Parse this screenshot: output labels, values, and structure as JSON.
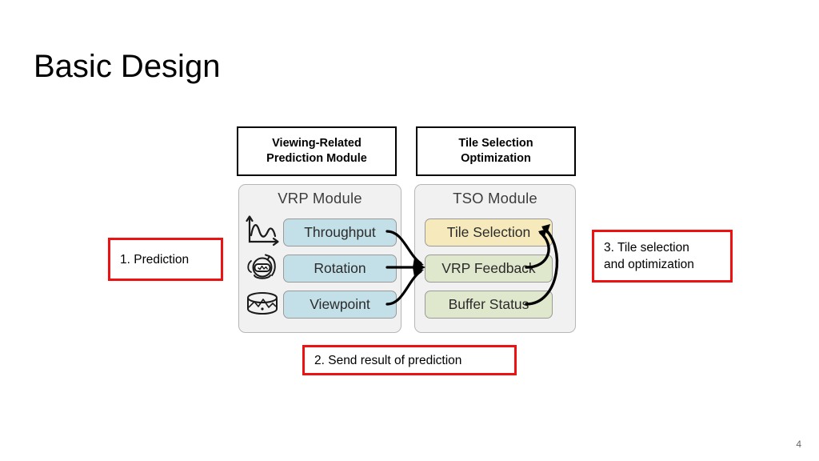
{
  "slide": {
    "title": "Basic Design",
    "page_number": "4"
  },
  "diagram": {
    "captions": {
      "left": "Viewing-Related\nPrediction Module",
      "left_line1": "Viewing-Related",
      "left_line2": "Prediction Module",
      "right_line1": "Tile Selection",
      "right_line2": "Optimization"
    },
    "modules": [
      {
        "id": "vrp",
        "title": "VRP Module",
        "items": [
          {
            "label": "Throughput",
            "icon": "line-chart-icon",
            "color": "#c3e0e8"
          },
          {
            "label": "Rotation",
            "icon": "vr-headset-rotation-icon",
            "color": "#c3e0e8"
          },
          {
            "label": "Viewpoint",
            "icon": "panorama-cylinder-icon",
            "color": "#c3e0e8"
          }
        ]
      },
      {
        "id": "tso",
        "title": "TSO Module",
        "items": [
          {
            "label": "Tile Selection",
            "color": "#f6e9bc"
          },
          {
            "label": "VRP Feedback",
            "color": "#dfe8cd"
          },
          {
            "label": "Buffer Status",
            "color": "#dfe8cd"
          }
        ]
      }
    ]
  },
  "annotations": [
    {
      "id": "prediction",
      "text": "1. Prediction"
    },
    {
      "id": "send-result",
      "text": "2. Send result of prediction"
    },
    {
      "id": "tile-select",
      "line1": "3. Tile selection",
      "line2": "and optimization"
    }
  ],
  "colors": {
    "annotation_border": "#ee1111",
    "module_bg": "#f1f1f1",
    "module_border": "#b7b7b7",
    "chip_blue": "#c3e0e8",
    "chip_yellow": "#f6e9bc",
    "chip_green": "#dfe8cd",
    "text": "#000000"
  }
}
